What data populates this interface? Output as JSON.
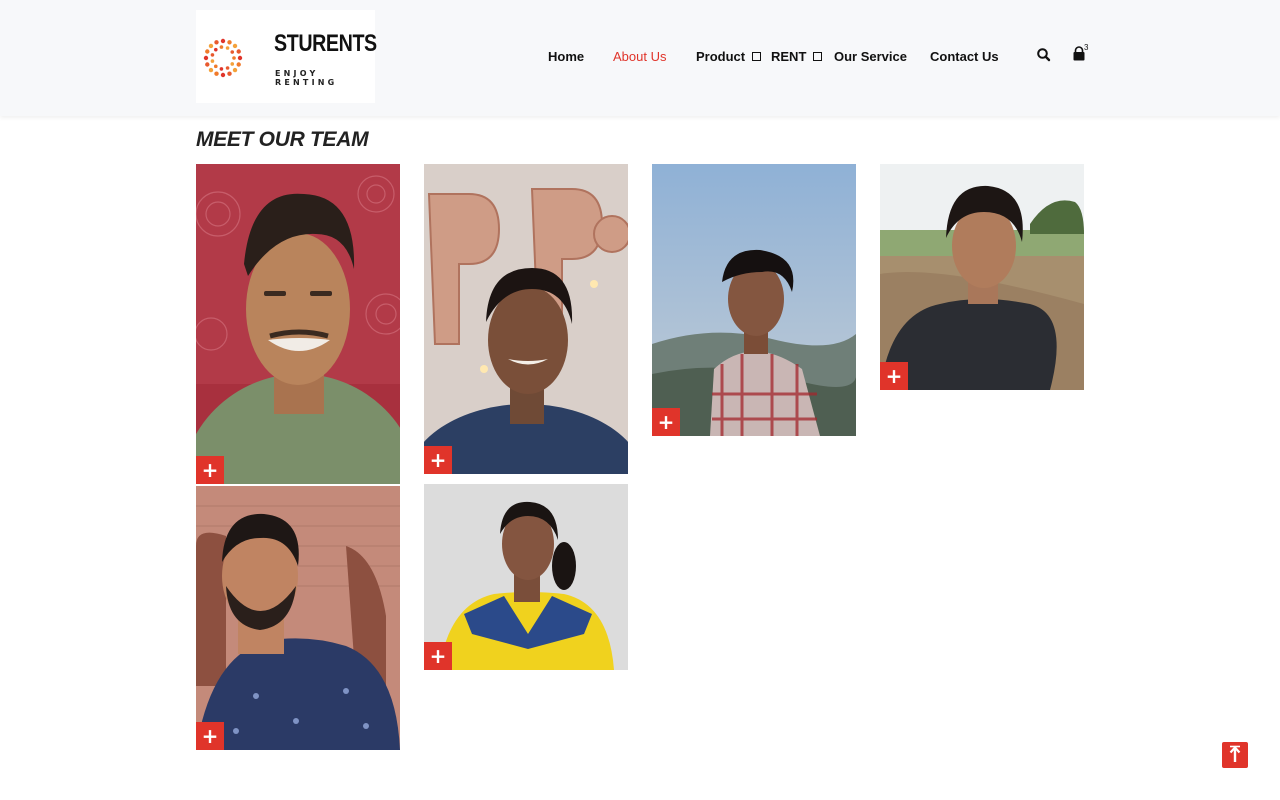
{
  "brand": {
    "name": "STURENTS",
    "tagline": "ENJOY RENTING",
    "accent_color": "#e0342a"
  },
  "nav": {
    "items": [
      {
        "label": "Home",
        "active": false
      },
      {
        "label": "About Us",
        "active": true
      },
      {
        "label": "Product",
        "has_dropdown": true
      },
      {
        "label": "RENT",
        "has_dropdown": true
      },
      {
        "label": "Our Service",
        "active": false
      },
      {
        "label": "Contact Us",
        "active": false
      }
    ],
    "search_icon": "search-icon",
    "cart_icon": "shopping-bag-icon",
    "cart_count": "3"
  },
  "section": {
    "title": "MEET OUR TEAM"
  },
  "team": [
    {
      "expand_icon": "plus-icon"
    },
    {
      "expand_icon": "plus-icon"
    },
    {
      "expand_icon": "plus-icon"
    },
    {
      "expand_icon": "plus-icon"
    },
    {
      "expand_icon": "plus-icon"
    },
    {
      "expand_icon": "plus-icon"
    }
  ],
  "scroll_top_icon": "arrow-up-icon",
  "plus_glyph": "+"
}
